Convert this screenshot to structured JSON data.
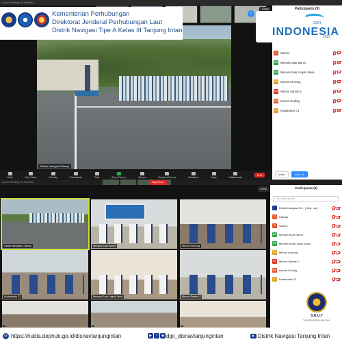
{
  "top_window": {
    "title": "Zoom Meeting 40 Minutes",
    "view_label": "View",
    "main_video_name": "Distrik Navigasi Cilacap",
    "toolbar": [
      {
        "label": "Mute",
        "icon": "mic-icon"
      },
      {
        "label": "Stop Video",
        "icon": "video-icon"
      },
      {
        "label": "Security",
        "icon": "shield-icon"
      },
      {
        "label": "Participants",
        "icon": "people-icon"
      },
      {
        "label": "Chat",
        "icon": "chat-icon"
      },
      {
        "label": "Share Screen",
        "icon": "share-icon"
      },
      {
        "label": "Record",
        "icon": "record-icon"
      },
      {
        "label": "Breakout Rooms",
        "icon": "rooms-icon"
      },
      {
        "label": "Reactions",
        "icon": "reaction-icon"
      },
      {
        "label": "Apps",
        "icon": "apps-icon"
      },
      {
        "label": "Whiteboards",
        "icon": "whiteboard-icon"
      }
    ],
    "end_label": "End"
  },
  "header": {
    "line1": "Kementerian Perhubungan",
    "line2": "Direktorat Jenderal Perhubungan Laut",
    "line3": "Distrik Navigasi Tipe A Kelas III Tanjung Intan"
  },
  "indonesia_badge": {
    "word": "INDONESIA",
    "year_left": "2024",
    "year_right": "2025"
  },
  "participants_top": {
    "title": "Participants (9)",
    "items": [
      {
        "initials": "S",
        "name": "Sanino",
        "color": "#e05a2b"
      },
      {
        "initials": "MS",
        "name": "Menara Suar Baron",
        "color": "#2ea84a"
      },
      {
        "initials": "MS",
        "name": "Menara Suar Legok Jawa",
        "color": "#2ea84a"
      },
      {
        "initials": "MK",
        "name": "Menus Krorong",
        "color": "#e0a020"
      },
      {
        "initials": "MS",
        "name": "Menus Samas 2",
        "color": "#d9342b"
      },
      {
        "initials": "MG",
        "name": "menus Goding",
        "color": "#e05a2b"
      },
      {
        "initials": "K7",
        "name": "Kudamanis 71",
        "color": "#e0a020"
      }
    ],
    "invite_label": "Invite",
    "mute_all_label": "Mute All"
  },
  "bottom_window": {
    "title": "Zoom Meeting 40 Minutes",
    "share_label": "Stop Share",
    "view_label": "View",
    "tiles": [
      {
        "name": "Distrik Navigasi Cilacap"
      },
      {
        "name": "Menara Suar Baron"
      },
      {
        "name": "Menus Krorong"
      },
      {
        "name": "Kudamanis 71"
      },
      {
        "name": "Menara Suar Legok Jawa"
      },
      {
        "name": "Menus Samas 2"
      },
      {
        "name": ""
      },
      {
        "name": ""
      },
      {
        "name": ""
      }
    ]
  },
  "participants_bottom": {
    "title": "Participants (9)",
    "search_placeholder": "Find participants",
    "items": [
      {
        "initials": "",
        "name": "Distrik Navigasi Cil... (Host, me)",
        "color": "#1d3b8a"
      },
      {
        "initials": "C",
        "name": "Cilacap",
        "color": "#e05a2b"
      },
      {
        "initials": "S",
        "name": "Sanino",
        "color": "#e05a2b"
      },
      {
        "initials": "MS",
        "name": "Menara Suar Baron",
        "color": "#2ea84a"
      },
      {
        "initials": "MS",
        "name": "Menara Suar Legok Jawa",
        "color": "#2ea84a"
      },
      {
        "initials": "MK",
        "name": "Menus Krorong",
        "color": "#e0a020"
      },
      {
        "initials": "MS",
        "name": "Menus Samas 2",
        "color": "#d9342b"
      },
      {
        "initials": "MG",
        "name": "menus Goding",
        "color": "#e05a2b"
      },
      {
        "initials": "K7",
        "name": "Kudamanis 71",
        "color": "#e0a020"
      }
    ]
  },
  "srut": {
    "name": "S.R.U.T",
    "tagline": "Social Media Response Team"
  },
  "footer": {
    "website": "https://hubla.dephub.go.id/disnavtanjungintan",
    "social": "djpl_disnavtanjungintan",
    "youtube": "Distrik Navigasi Tanjung Intan"
  }
}
